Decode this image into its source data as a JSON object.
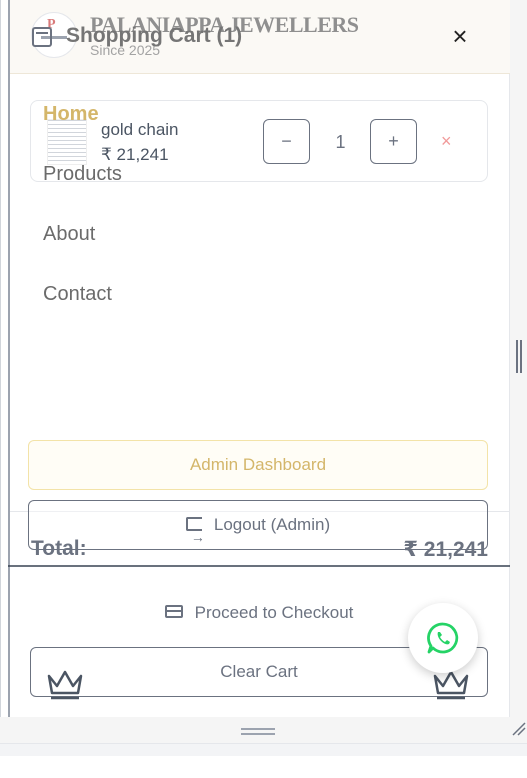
{
  "header": {
    "brand": "PALANIAPPA JEWELLERS",
    "since": "Since 2025",
    "logo_letter": "P"
  },
  "cart": {
    "title": "Shopping Cart (1)",
    "close_symbol": "×",
    "items": [
      {
        "name": "gold chain",
        "price": "₹ 21,241",
        "quantity": "1",
        "minus_symbol": "−",
        "plus_symbol": "+",
        "remove_symbol": "×"
      }
    ],
    "total_label": "Total:",
    "total_value": "₹ 21,241",
    "checkout_label": "Proceed to Checkout",
    "clear_label": "Clear Cart"
  },
  "nav": {
    "items": [
      {
        "label": "Home",
        "active": true
      },
      {
        "label": "Products"
      },
      {
        "label": "About"
      },
      {
        "label": "Contact"
      }
    ],
    "admin_dashboard": "Admin Dashboard",
    "logout": "Logout (Admin)"
  },
  "colors": {
    "accent_gold": "#d4b66a",
    "remove_red": "#f19a9a",
    "whatsapp_green": "#25d366"
  },
  "icons": {
    "cart": "shopping-cart-icon",
    "close": "close-icon",
    "logout": "logout-icon",
    "checkout": "credit-card-icon",
    "crown": "crown-icon",
    "whatsapp": "whatsapp-icon"
  }
}
